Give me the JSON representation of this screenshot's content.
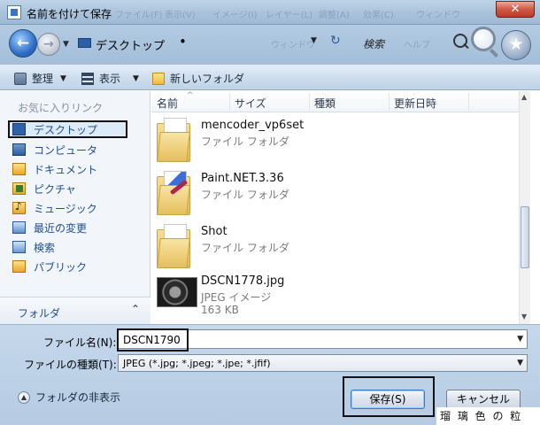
{
  "window": {
    "title": "名前を付けて保存",
    "close_label": "✕",
    "ghost_menu": [
      "ファイル(F)",
      "表示(V)",
      "イメージ(I)",
      "レイヤー(L)",
      "調整(A)",
      "効果(C)",
      "ウィンドウ"
    ]
  },
  "address": {
    "location": "デスクトップ",
    "separator": "•",
    "ghost_text": "ウィンドウ",
    "search_label": "検索",
    "search_ghost": "ヘルプ"
  },
  "toolbar": {
    "organize": "整理",
    "views": "表示",
    "new_folder": "新しいフォルダ"
  },
  "sidebar": {
    "header": "お気に入りリンク",
    "items": [
      {
        "label": "デスクトップ",
        "icon": "desktop-icon"
      },
      {
        "label": "コンピュータ",
        "icon": "computer-icon"
      },
      {
        "label": "ドキュメント",
        "icon": "documents-icon"
      },
      {
        "label": "ピクチャ",
        "icon": "pictures-icon"
      },
      {
        "label": "ミュージック",
        "icon": "music-icon"
      },
      {
        "label": "最近の変更",
        "icon": "recent-icon"
      },
      {
        "label": "検索",
        "icon": "search-folder-icon"
      },
      {
        "label": "パブリック",
        "icon": "public-icon"
      }
    ],
    "footer": "フォルダ",
    "footer_chevron": "⌃"
  },
  "filelist": {
    "columns": [
      "名前",
      "サイズ",
      "種類",
      "更新日時"
    ],
    "sort_marker": "^",
    "files": [
      {
        "name": "mencoder_vp6set",
        "type": "ファイル フォルダ",
        "size": ""
      },
      {
        "name": "Paint.NET.3.36",
        "type": "ファイル フォルダ",
        "size": ""
      },
      {
        "name": "Shot",
        "type": "ファイル フォルダ",
        "size": ""
      },
      {
        "name": "DSCN1778.jpg",
        "type": "JPEG イメージ",
        "size": "163 KB"
      }
    ]
  },
  "form": {
    "filename_label": "ファイル名(N):",
    "filename_value": "DSCN1790",
    "filetype_label": "ファイルの種類(T):",
    "filetype_value": "JPEG (*.jpg; *.jpeg; *.jpe; *.jfif)",
    "hide_folders": "フォルダの非表示",
    "save_button": "保存(S)",
    "cancel_button": "キャンセル"
  },
  "watermark": "瑠 璃 色 の 粒",
  "colors": {
    "titlebar": "#a9c3dc",
    "link_blue": "#1d4f8f",
    "close_red": "#c0392b",
    "selection": "#ddeaf8"
  }
}
